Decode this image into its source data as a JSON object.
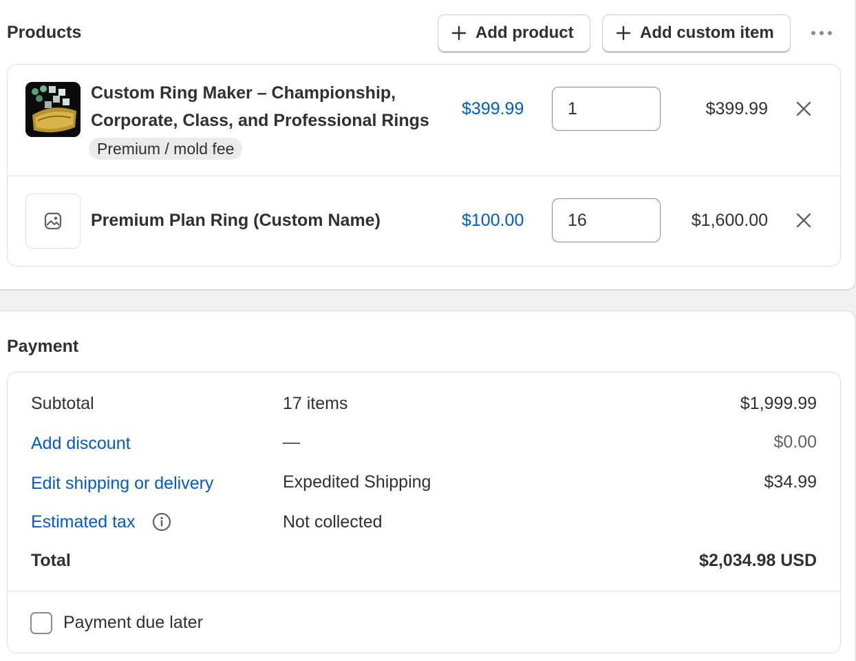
{
  "products": {
    "title": "Products",
    "add_product_label": "Add product",
    "add_custom_item_label": "Add custom item",
    "items": [
      {
        "title_line1": "Custom Ring Maker – Championship,",
        "title_line2": "Corporate, Class, and Professional Rings",
        "variant": "Premium / mold fee",
        "price": "$399.99",
        "quantity": "1",
        "total": "$399.99",
        "image_icon": "ring-product-image"
      },
      {
        "title": "Premium Plan Ring (Custom Name)",
        "price": "$100.00",
        "quantity": "16",
        "total": "$1,600.00",
        "image_icon": "image-placeholder-icon"
      }
    ]
  },
  "payment": {
    "title": "Payment",
    "subtotal_label": "Subtotal",
    "subtotal_items": "17 items",
    "subtotal_amount": "$1,999.99",
    "discount_label": "Add discount",
    "discount_value": "—",
    "discount_amount": "$0.00",
    "shipping_label": "Edit shipping or delivery",
    "shipping_value": "Expedited Shipping",
    "shipping_amount": "$34.99",
    "tax_label": "Estimated tax",
    "tax_value": "Not collected",
    "total_label": "Total",
    "total_amount": "$2,034.98 USD",
    "payment_due_later_label": "Payment due later",
    "payment_due_later_checked": false
  },
  "colors": {
    "link": "#005bd3",
    "text": "#303030",
    "background": "#f1f1f1"
  }
}
